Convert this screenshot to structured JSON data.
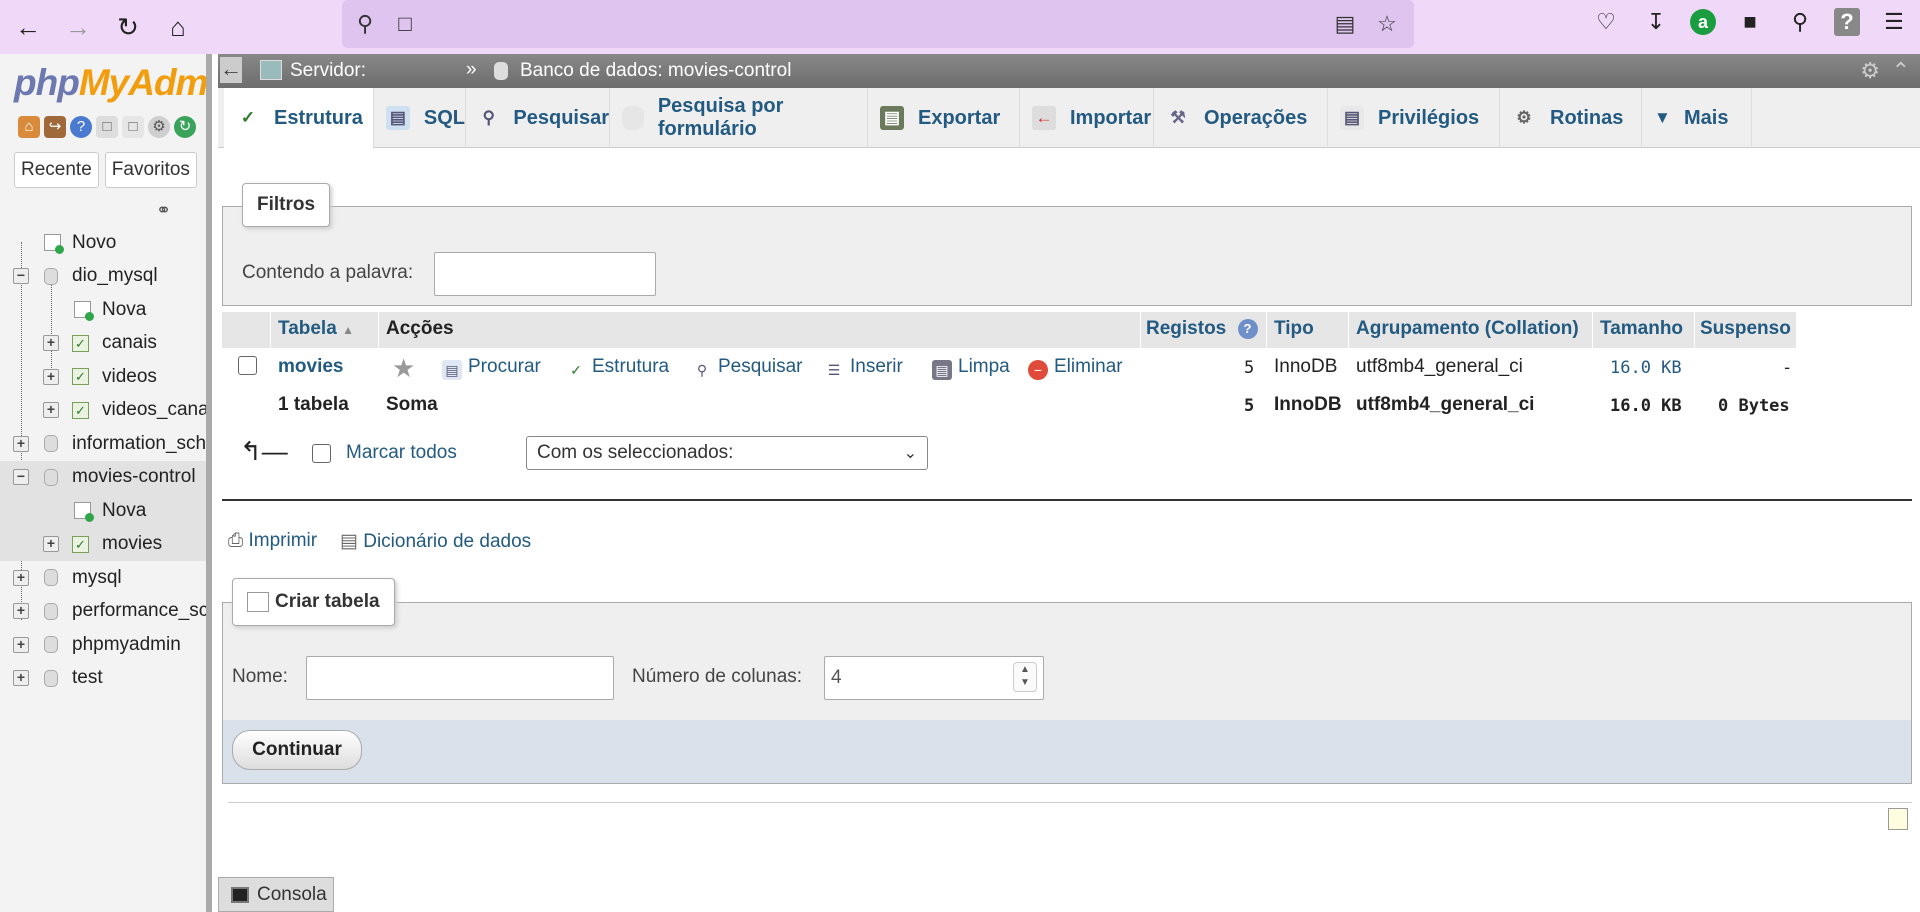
{
  "browser": {
    "back_icon": "arrow-left-icon",
    "forward_icon": "arrow-right-icon",
    "reload_icon": "reload-icon",
    "home_icon": "home-icon"
  },
  "leftnav": {
    "logo": {
      "php": "php",
      "my": "My",
      "admin": "Adm"
    },
    "recent_label": "Recente",
    "favorites_label": "Favoritos",
    "tree": {
      "novo": "Novo",
      "dio_mysql": "dio_mysql",
      "dio_nova": "Nova",
      "canais": "canais",
      "videos": "videos",
      "videos_canais": "videos_cana",
      "information_schema": "information_sch",
      "movies_control": "movies-control",
      "mc_nova": "Nova",
      "movies": "movies",
      "mysql": "mysql",
      "performance_schema": "performance_sc",
      "phpmyadmin": "phpmyadmin",
      "test": "test"
    }
  },
  "topbar": {
    "server": "Servidor:",
    "sep": "»",
    "database": "Banco de dados: movies-control"
  },
  "tabs": {
    "estrutura": "Estrutura",
    "sql": "SQL",
    "pesquisar": "Pesquisar",
    "pesquisa_form": "Pesquisa por formulário",
    "exportar": "Exportar",
    "importar": "Importar",
    "operacoes": "Operações",
    "privilegios": "Privilégios",
    "rotinas": "Rotinas",
    "mais": "Mais"
  },
  "filters": {
    "legend": "Filtros",
    "label": "Contendo a palavra:",
    "value": ""
  },
  "table": {
    "headers": {
      "tabela": "Tabela",
      "accoes": "Acções",
      "registos": "Registos",
      "tipo": "Tipo",
      "collation": "Agrupamento (Collation)",
      "tamanho": "Tamanho",
      "suspenso": "Suspenso"
    },
    "row": {
      "name": "movies",
      "procurar": "Procurar",
      "estrutura": "Estrutura",
      "pesquisar": "Pesquisar",
      "inserir": "Inserir",
      "limpa": "Limpa",
      "eliminar": "Eliminar",
      "registos": "5",
      "tipo": "InnoDB",
      "collation": "utf8mb4_general_ci",
      "tamanho": "16.0 KB",
      "suspenso": "-"
    },
    "footer": {
      "count": "1 tabela",
      "soma": "Soma",
      "registos": "5",
      "tipo": "InnoDB",
      "collation": "utf8mb4_general_ci",
      "tamanho": "16.0 KB",
      "suspenso": "0 Bytes"
    }
  },
  "bulk": {
    "mark_all": "Marcar todos",
    "select_value": "Com os seleccionados:"
  },
  "links": {
    "print": "Imprimir",
    "dictionary": "Dicionário de dados"
  },
  "create": {
    "legend": "Criar tabela",
    "name_label": "Nome:",
    "name_value": "",
    "cols_label": "Número de colunas:",
    "cols_value": "4",
    "continue": "Continuar"
  },
  "console": "Consola"
}
